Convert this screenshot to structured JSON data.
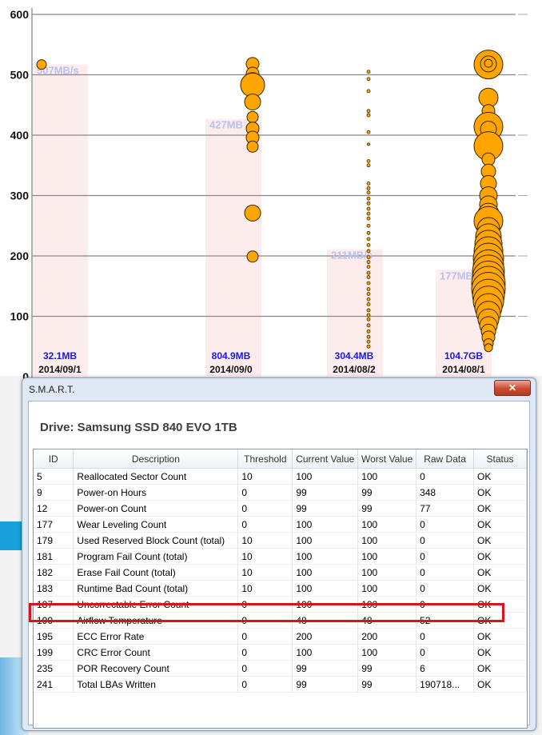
{
  "chart_data": {
    "type": "scatter",
    "ylim": [
      0,
      600
    ],
    "y_ticks": [
      "0",
      "100",
      "200",
      "300",
      "400",
      "500",
      "600"
    ],
    "groups": [
      {
        "date": "2014/09/1",
        "size_label": "32.1MB",
        "speed_label": "507MB/s",
        "speed": 517,
        "points": [
          {
            "y": 517,
            "r": 6
          }
        ]
      },
      {
        "date": "2014/09/0",
        "size_label": "804.9MB",
        "speed_label": "427MB",
        "speed": 427,
        "points": [
          {
            "y": 518,
            "r": 8
          },
          {
            "y": 502,
            "r": 8
          },
          {
            "y": 489,
            "r": 11
          },
          {
            "y": 483,
            "r": 15
          },
          {
            "y": 455,
            "r": 10
          },
          {
            "y": 430,
            "r": 7
          },
          {
            "y": 411,
            "r": 8
          },
          {
            "y": 396,
            "r": 8
          },
          {
            "y": 381,
            "r": 7
          },
          {
            "y": 271,
            "r": 10
          },
          {
            "y": 199,
            "r": 7
          }
        ]
      },
      {
        "date": "2014/08/2",
        "size_label": "304.4MB",
        "speed_label": "211MB/s",
        "speed": 211,
        "points": [
          {
            "y": 505,
            "r": 2
          },
          {
            "y": 493,
            "r": 2
          },
          {
            "y": 473,
            "r": 2
          },
          {
            "y": 440,
            "r": 2
          },
          {
            "y": 433,
            "r": 2
          },
          {
            "y": 405,
            "r": 2
          },
          {
            "y": 385,
            "r": 1.5
          },
          {
            "y": 357,
            "r": 2
          },
          {
            "y": 350,
            "r": 2
          },
          {
            "y": 320,
            "r": 2
          },
          {
            "y": 312,
            "r": 2
          },
          {
            "y": 305,
            "r": 2
          },
          {
            "y": 295,
            "r": 2
          },
          {
            "y": 287,
            "r": 2
          },
          {
            "y": 278,
            "r": 2
          },
          {
            "y": 270,
            "r": 2
          },
          {
            "y": 262,
            "r": 2
          },
          {
            "y": 250,
            "r": 2
          },
          {
            "y": 238,
            "r": 2
          },
          {
            "y": 228,
            "r": 2
          },
          {
            "y": 218,
            "r": 2
          },
          {
            "y": 208,
            "r": 2
          },
          {
            "y": 198,
            "r": 2
          },
          {
            "y": 190,
            "r": 2
          },
          {
            "y": 182,
            "r": 2
          },
          {
            "y": 172,
            "r": 2
          },
          {
            "y": 165,
            "r": 2
          },
          {
            "y": 155,
            "r": 2
          },
          {
            "y": 145,
            "r": 2
          },
          {
            "y": 137,
            "r": 2
          },
          {
            "y": 128,
            "r": 2
          },
          {
            "y": 120,
            "r": 2
          },
          {
            "y": 110,
            "r": 2
          },
          {
            "y": 102,
            "r": 2
          },
          {
            "y": 95,
            "r": 2
          },
          {
            "y": 85,
            "r": 2
          },
          {
            "y": 75,
            "r": 2
          },
          {
            "y": 66,
            "r": 2
          },
          {
            "y": 58,
            "r": 2
          },
          {
            "y": 50,
            "r": 2
          }
        ]
      },
      {
        "date": "2014/08/1",
        "size_label": "104.7GB",
        "speed_label": "177MB",
        "speed": 177,
        "points": [
          {
            "y": 517,
            "r": 18
          },
          {
            "y": 518,
            "r": 10
          },
          {
            "y": 519,
            "r": 5
          },
          {
            "y": 462,
            "r": 12
          },
          {
            "y": 440,
            "r": 8
          },
          {
            "y": 414,
            "r": 18
          },
          {
            "y": 410,
            "r": 10
          },
          {
            "y": 382,
            "r": 18
          },
          {
            "y": 360,
            "r": 8
          },
          {
            "y": 340,
            "r": 9
          },
          {
            "y": 320,
            "r": 10
          },
          {
            "y": 300,
            "r": 11
          },
          {
            "y": 285,
            "r": 11
          },
          {
            "y": 270,
            "r": 13
          },
          {
            "y": 258,
            "r": 18
          },
          {
            "y": 245,
            "r": 14
          },
          {
            "y": 232,
            "r": 16
          },
          {
            "y": 220,
            "r": 17
          },
          {
            "y": 208,
            "r": 18
          },
          {
            "y": 196,
            "r": 19
          },
          {
            "y": 185,
            "r": 19
          },
          {
            "y": 175,
            "r": 20
          },
          {
            "y": 165,
            "r": 20
          },
          {
            "y": 155,
            "r": 21
          },
          {
            "y": 145,
            "r": 21
          },
          {
            "y": 135,
            "r": 20
          },
          {
            "y": 125,
            "r": 19
          },
          {
            "y": 115,
            "r": 17
          },
          {
            "y": 105,
            "r": 15
          },
          {
            "y": 95,
            "r": 13
          },
          {
            "y": 85,
            "r": 11
          },
          {
            "y": 75,
            "r": 9
          },
          {
            "y": 65,
            "r": 8
          },
          {
            "y": 55,
            "r": 6
          },
          {
            "y": 48,
            "r": 5
          }
        ]
      }
    ]
  },
  "smart": {
    "window_title": "S.M.A.R.T.",
    "close_icon": "close-x-icon",
    "drive_title": "Drive: Samsung SSD 840 EVO 1TB",
    "columns": [
      "ID",
      "Description",
      "Threshold",
      "Current Value",
      "Worst Value",
      "Raw Data",
      "Status"
    ],
    "rows": [
      [
        "5",
        "Reallocated Sector Count",
        "10",
        "100",
        "100",
        "0",
        "OK"
      ],
      [
        "9",
        "Power-on Hours",
        "0",
        "99",
        "99",
        "348",
        "OK"
      ],
      [
        "12",
        "Power-on Count",
        "0",
        "99",
        "99",
        "77",
        "OK"
      ],
      [
        "177",
        "Wear Leveling Count",
        "0",
        "100",
        "100",
        "0",
        "OK"
      ],
      [
        "179",
        "Used Reserved Block Count (total)",
        "10",
        "100",
        "100",
        "0",
        "OK"
      ],
      [
        "181",
        "Program Fail Count (total)",
        "10",
        "100",
        "100",
        "0",
        "OK"
      ],
      [
        "182",
        "Erase Fail Count (total)",
        "10",
        "100",
        "100",
        "0",
        "OK"
      ],
      [
        "183",
        "Runtime Bad Count (total)",
        "10",
        "100",
        "100",
        "0",
        "OK"
      ],
      [
        "187",
        "Uncorrectable Error Count",
        "0",
        "100",
        "100",
        "0",
        "OK"
      ],
      [
        "190",
        "Airflow Temperature",
        "0",
        "48",
        "48",
        "52",
        "OK"
      ],
      [
        "195",
        "ECC Error Rate",
        "0",
        "200",
        "200",
        "0",
        "OK"
      ],
      [
        "199",
        "CRC Error Count",
        "0",
        "100",
        "100",
        "0",
        "OK"
      ],
      [
        "235",
        "POR Recovery Count",
        "0",
        "99",
        "99",
        "6",
        "OK"
      ],
      [
        "241",
        "Total LBAs Written",
        "0",
        "99",
        "99",
        "190718...",
        "OK"
      ]
    ],
    "highlighted_row_id": "190",
    "highlight_color": "#d9121e",
    "accent_bubble_color": "#ffa500"
  }
}
